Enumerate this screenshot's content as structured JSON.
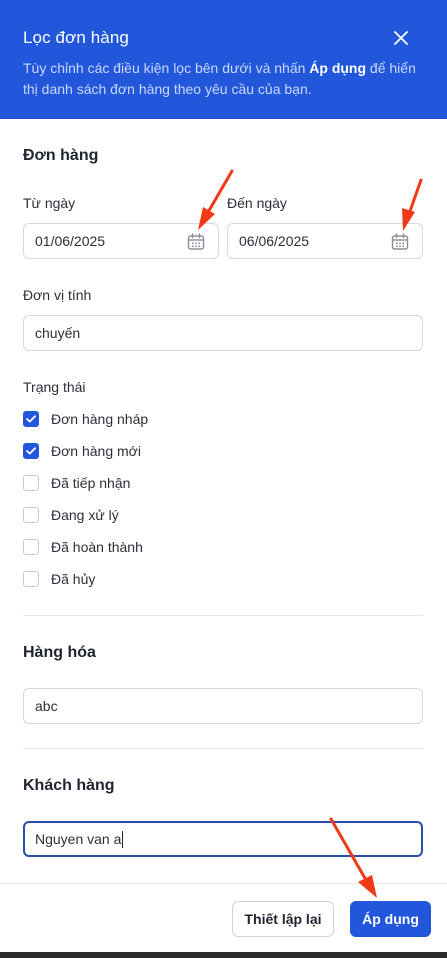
{
  "header": {
    "title": "Lọc đơn hàng",
    "desc_before": "Tùy chỉnh các điều kiện lọc bên dưới và nhấn ",
    "desc_bold": "Áp dụng",
    "desc_after": " để hiển thị danh sách đơn hàng theo yêu cầu của bạn."
  },
  "orders": {
    "title": "Đơn hàng",
    "from_label": "Từ ngày",
    "from_value": "01/06/2025",
    "to_label": "Đến ngày",
    "to_value": "06/06/2025",
    "unit_label": "Đơn vị tính",
    "unit_value": "chuyến",
    "status_label": "Trạng thái",
    "statuses": [
      {
        "label": "Đơn hàng nháp",
        "checked": true
      },
      {
        "label": "Đơn hàng mới",
        "checked": true
      },
      {
        "label": "Đã tiếp nhận",
        "checked": false
      },
      {
        "label": "Đang xử lý",
        "checked": false
      },
      {
        "label": "Đã hoàn thành",
        "checked": false
      },
      {
        "label": "Đã hủy",
        "checked": false
      }
    ]
  },
  "goods": {
    "title": "Hàng hóa",
    "value": "abc"
  },
  "customer": {
    "title": "Khách hàng",
    "value": "Nguyen van a"
  },
  "footer": {
    "reset_label": "Thiết lập lại",
    "apply_label": "Áp dụng"
  },
  "colors": {
    "primary": "#2357db",
    "annotation_arrow": "#f03a17"
  }
}
